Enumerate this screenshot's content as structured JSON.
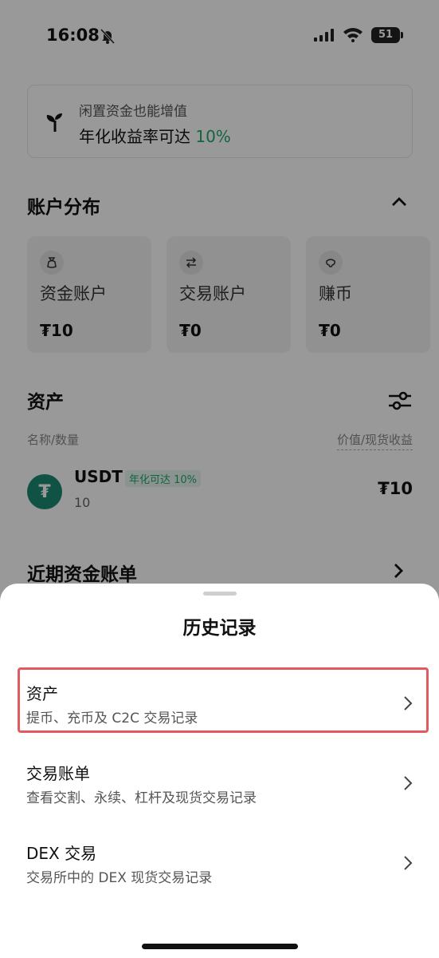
{
  "status_bar": {
    "time": "16:08",
    "battery": "51"
  },
  "promo": {
    "line1": "闲置资金也能增值",
    "line2_prefix": "年化收益率可达 ",
    "line2_rate": "10%"
  },
  "account_distribution": {
    "title": "账户分布",
    "cards": [
      {
        "name": "资金账户",
        "value": "₮10",
        "icon": "money-bag-icon"
      },
      {
        "name": "交易账户",
        "value": "₮0",
        "icon": "swap-icon"
      },
      {
        "name": "赚币",
        "value": "₮0",
        "icon": "piggy-icon"
      }
    ]
  },
  "assets": {
    "title": "资产",
    "col_left": "名称/数量",
    "col_right": "价值/现货收益",
    "items": [
      {
        "symbol": "USDT",
        "badge": "年化可达 10%",
        "qty": "10",
        "value": "₮10",
        "icon_glyph": "₮"
      }
    ]
  },
  "recent": {
    "title": "近期资金账单"
  },
  "sheet": {
    "title": "历史记录",
    "rows": [
      {
        "title": "资产",
        "subtitle": "提币、充币及 C2C 交易记录"
      },
      {
        "title": "交易账单",
        "subtitle": "查看交割、永续、杠杆及现货交易记录"
      },
      {
        "title": "DEX 交易",
        "subtitle": "交易所中的 DEX 现货交易记录"
      }
    ]
  },
  "colors": {
    "accent_green": "#20a86a",
    "usdt_green": "#1b8a72",
    "highlight_red": "#e05a5f"
  }
}
